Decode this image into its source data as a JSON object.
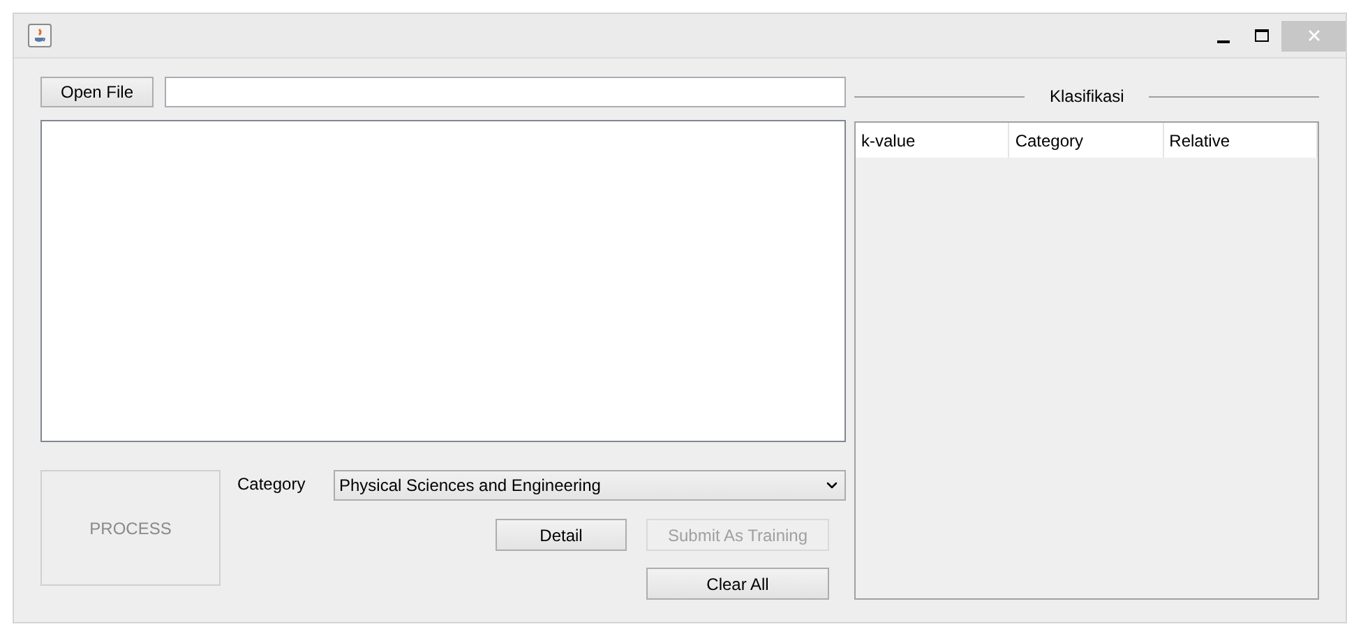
{
  "open_file_button": {
    "label": "Open File"
  },
  "process_button": {
    "label": "PROCESS",
    "disabled": true
  },
  "category": {
    "label": "Category",
    "value": "Physical Sciences and Engineering"
  },
  "buttons": [
    {
      "label": "Detail",
      "disabled": false
    },
    {
      "label": "Submit As Training",
      "disabled": true
    },
    {
      "label": "Clear All",
      "disabled": false
    }
  ],
  "klasifikasi": {
    "title": "Klasifikasi",
    "columns": [
      "k-value",
      "Category",
      "Relative"
    ]
  }
}
